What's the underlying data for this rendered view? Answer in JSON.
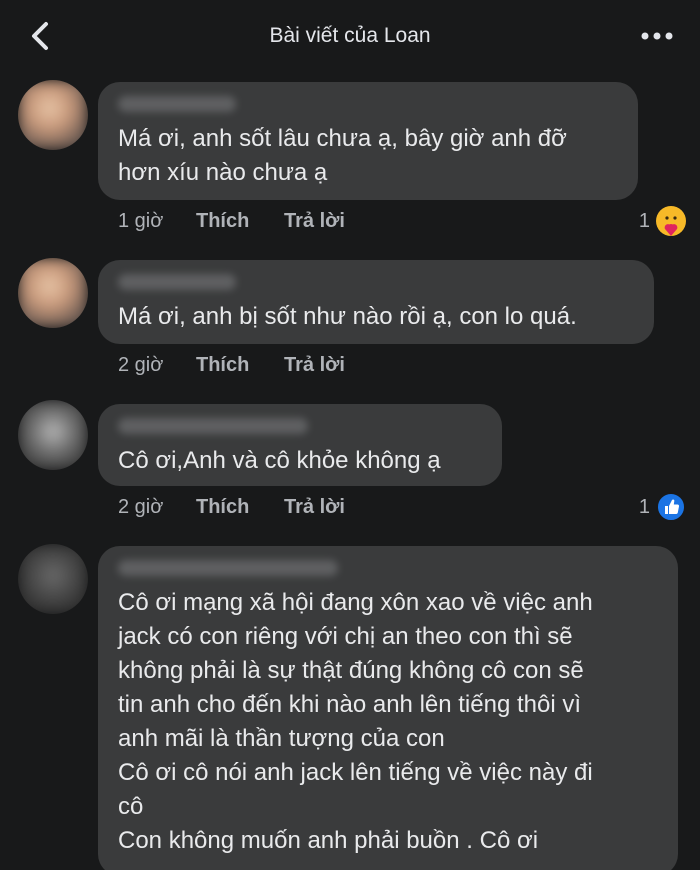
{
  "header": {
    "title": "Bài viết của Loan",
    "back_icon": "chevron-left-icon",
    "more_icon": "more-horizontal-icon"
  },
  "comments": [
    {
      "text": "Má ơi, anh sốt lâu chưa ạ, bây giờ anh đỡ\nhơn xíu nào chưa ạ",
      "time": "1 giờ",
      "like_label": "Thích",
      "reply_label": "Trả lời",
      "reaction_count": "1",
      "reaction_icon": "care-reaction-icon"
    },
    {
      "text": "Má ơi, anh bị sốt như nào rồi ạ, con lo quá.",
      "time": "2 giờ",
      "like_label": "Thích",
      "reply_label": "Trả lời"
    },
    {
      "text": "Cô ơi,Anh và cô khỏe không ạ",
      "time": "2 giờ",
      "like_label": "Thích",
      "reply_label": "Trả lời",
      "reaction_count": "1",
      "reaction_icon": "like-reaction-icon"
    },
    {
      "text": "Cô ơi mạng xã hội đang xôn xao về việc anh\njack có con riêng với chị an theo con thì sẽ\nkhông phải là sự thật đúng không cô con sẽ\ntin anh cho đến khi nào anh lên tiếng thôi vì\nanh mãi là thần tượng của con\nCô ơi cô nói anh jack lên tiếng về việc này đi\ncô\nCon không muốn anh phải buồn . Cô ơi"
    }
  ]
}
